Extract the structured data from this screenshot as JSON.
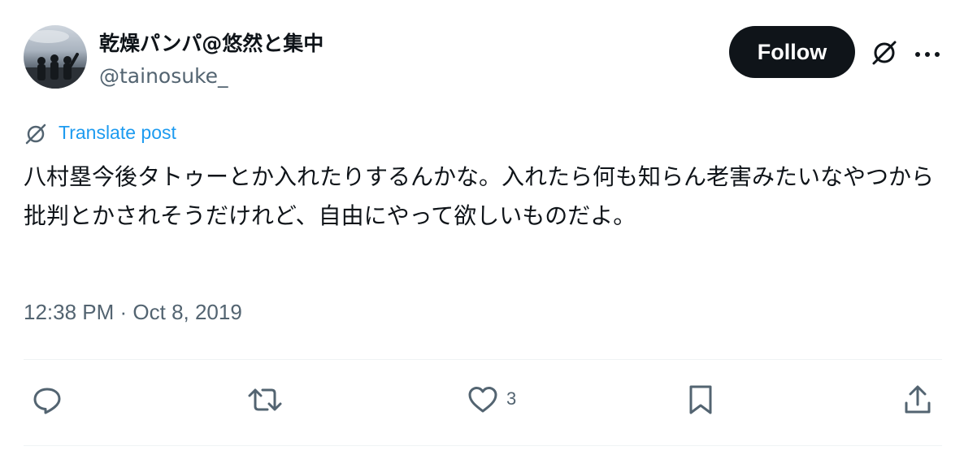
{
  "author": {
    "display_name": "乾燥パンパ@悠然と集中",
    "handle": "@tainosuke_"
  },
  "header": {
    "follow_label": "Follow",
    "icons": [
      "grok-icon",
      "more-icon"
    ]
  },
  "translate": {
    "label": "Translate post"
  },
  "tweet": {
    "text": "八村塁今後タトゥーとか入れたりするんかな。入れたら何も知らん老害みたいなやつから批判とかされそうだけれど、自由にやって欲しいものだよ。",
    "timestamp": "12:38 PM · Oct 8, 2019"
  },
  "actions": {
    "like_count": "3",
    "icons": [
      "reply-icon",
      "retweet-icon",
      "like-icon",
      "bookmark-icon",
      "share-icon"
    ]
  },
  "colors": {
    "text": "#0f1419",
    "secondary": "#536471",
    "link": "#1d9bf0",
    "button_bg": "#0f1419",
    "divider": "#eff3f4"
  }
}
